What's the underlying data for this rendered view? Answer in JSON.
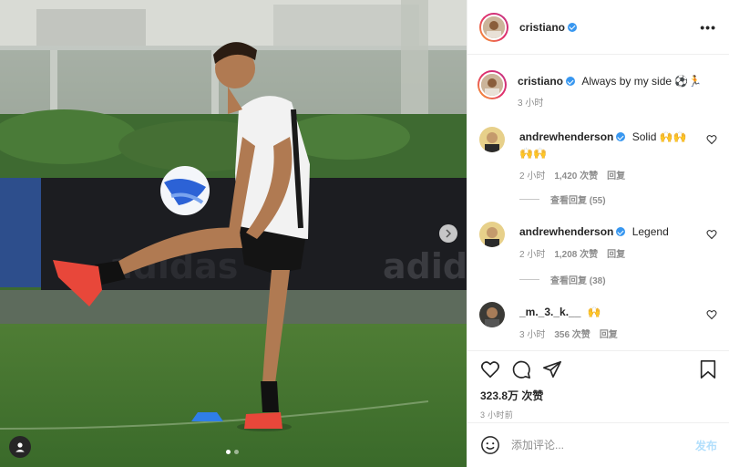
{
  "photo": {
    "background_text": "adidas",
    "active_slide": 1,
    "total_slides": 2
  },
  "header": {
    "username": "cristiano",
    "more_label": "•••"
  },
  "caption": {
    "username": "cristiano",
    "text": "Always by my side ⚽🏃",
    "time": "3 小时"
  },
  "comments": [
    {
      "username": "andrewhenderson",
      "verified": true,
      "text": "Solid 🙌🙌",
      "text_line2": "🙌🙌",
      "time": "2 小时",
      "likes": "1,420 次赞",
      "reply_label": "回复",
      "view_replies": "查看回复 (55)"
    },
    {
      "username": "andrewhenderson",
      "verified": true,
      "text": "Legend",
      "time": "2 小时",
      "likes": "1,208 次赞",
      "reply_label": "回复",
      "view_replies": "查看回复 (38)"
    },
    {
      "username": "_m._3._k.__",
      "verified": false,
      "text": "🙌",
      "time": "3 小时",
      "likes": "356 次赞",
      "reply_label": "回复"
    }
  ],
  "actions": {
    "like_count": "323.8万 次赞",
    "time_ago": "3 小时前"
  },
  "add_comment": {
    "placeholder": "添加评论...",
    "post_label": "发布"
  },
  "colors": {
    "accent": "#3897f0",
    "post_disabled": "#b2dffc",
    "muted": "#8e8e8e"
  }
}
